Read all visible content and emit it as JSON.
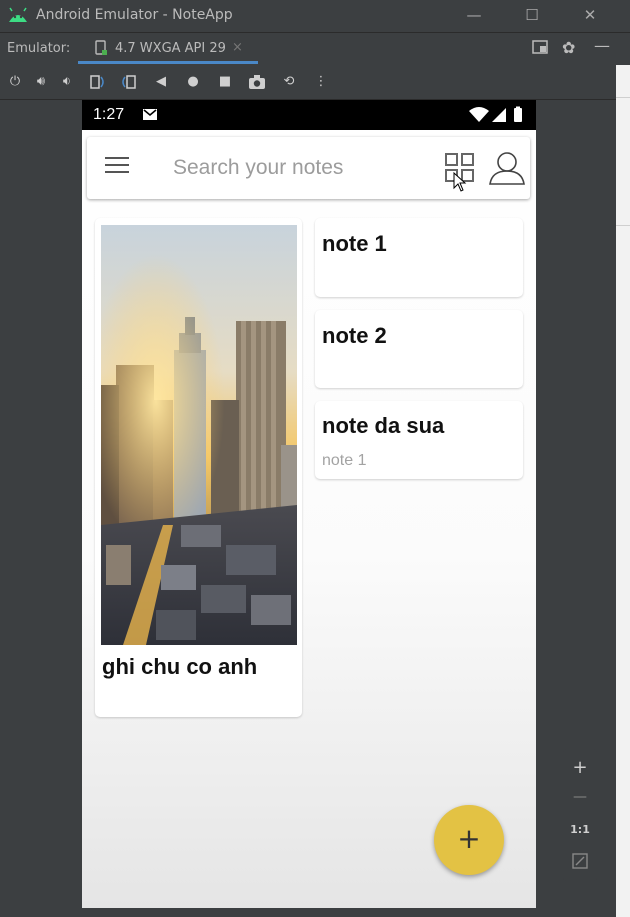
{
  "window": {
    "title": "Android Emulator - NoteApp",
    "minimize": "—",
    "maximize": "☐",
    "close": "✕"
  },
  "tabbar": {
    "emulator_label": "Emulator:",
    "device_tab": "4.7 WXGA API 29",
    "close_tab": "×"
  },
  "status": {
    "time": "1:27"
  },
  "search": {
    "placeholder": "Search your notes"
  },
  "notes": [
    {
      "title": "ghi chu co anh",
      "body": "",
      "has_image": true
    },
    {
      "title": "note 1",
      "body": ""
    },
    {
      "title": "note 2",
      "body": ""
    },
    {
      "title": "note da sua",
      "body": "note 1"
    }
  ],
  "fab": {
    "label": "+"
  },
  "zoom": {
    "plus": "+",
    "minus": "—",
    "ratio": "1:1"
  },
  "colors": {
    "fab": "#e3c244",
    "window": "#3c3f41",
    "tab_accent": "#4a88c7"
  }
}
